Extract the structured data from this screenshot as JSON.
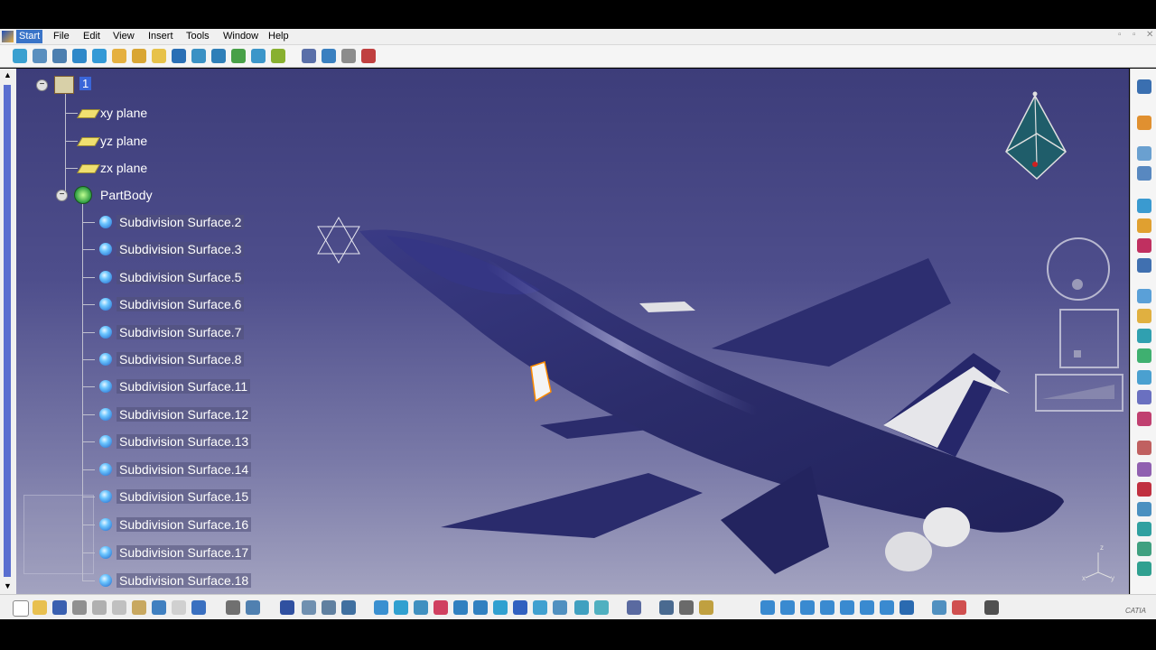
{
  "menu": {
    "start": "Start",
    "items": [
      "File",
      "Edit",
      "View",
      "Insert",
      "Tools",
      "Window",
      "Help"
    ]
  },
  "window_controls": [
    "▫",
    "▫",
    "✕"
  ],
  "tree": {
    "root_label": "1",
    "planes": [
      "xy plane",
      "yz plane",
      "zx plane"
    ],
    "body": "PartBody",
    "surfaces": [
      "Subdivision Surface.2",
      "Subdivision Surface.3",
      "Subdivision Surface.5",
      "Subdivision Surface.6",
      "Subdivision Surface.7",
      "Subdivision Surface.8",
      "Subdivision Surface.11",
      "Subdivision Surface.12",
      "Subdivision Surface.13",
      "Subdivision Surface.14",
      "Subdivision Surface.15",
      "Subdivision Surface.16",
      "Subdivision Surface.17",
      "Subdivision Surface.18"
    ]
  },
  "axis_labels": {
    "x": "x",
    "y": "y",
    "z": "z"
  },
  "brand": "CATIA",
  "colors": {
    "background_top": "#3d3d7a",
    "background_bottom": "#a3a3c0",
    "model": "#2e2f6e",
    "selection": "#ff8c00"
  }
}
